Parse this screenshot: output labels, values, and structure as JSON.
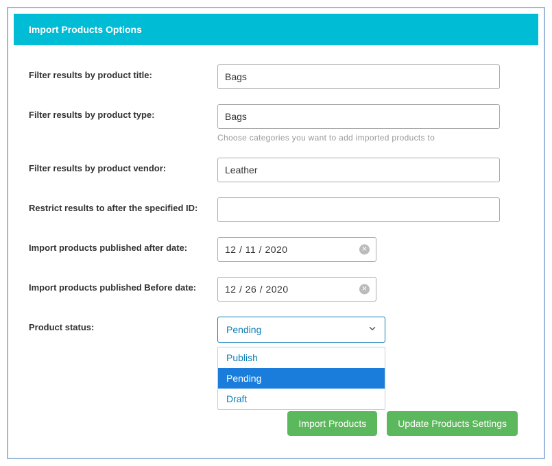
{
  "panel": {
    "title": "Import Products Options"
  },
  "fields": {
    "title": {
      "label": "Filter results by product title:",
      "value": "Bags"
    },
    "type": {
      "label": "Filter results by product type:",
      "value": "Bags",
      "help": "Choose categories you want to add imported products to"
    },
    "vendor": {
      "label": "Filter results by product vendor:",
      "value": "Leather"
    },
    "afterId": {
      "label": "Restrict results to after the specified ID:",
      "value": ""
    },
    "pubAfter": {
      "label": "Import products published after date:",
      "value": "12 / 11 / 2020"
    },
    "pubBefore": {
      "label": "Import products published Before date:",
      "value": "12 / 26 / 2020"
    },
    "status": {
      "label": "Product status:",
      "selected": "Pending",
      "options": [
        "Publish",
        "Pending",
        "Draft"
      ]
    }
  },
  "buttons": {
    "import": "Import Products",
    "update": "Update Products Settings"
  }
}
